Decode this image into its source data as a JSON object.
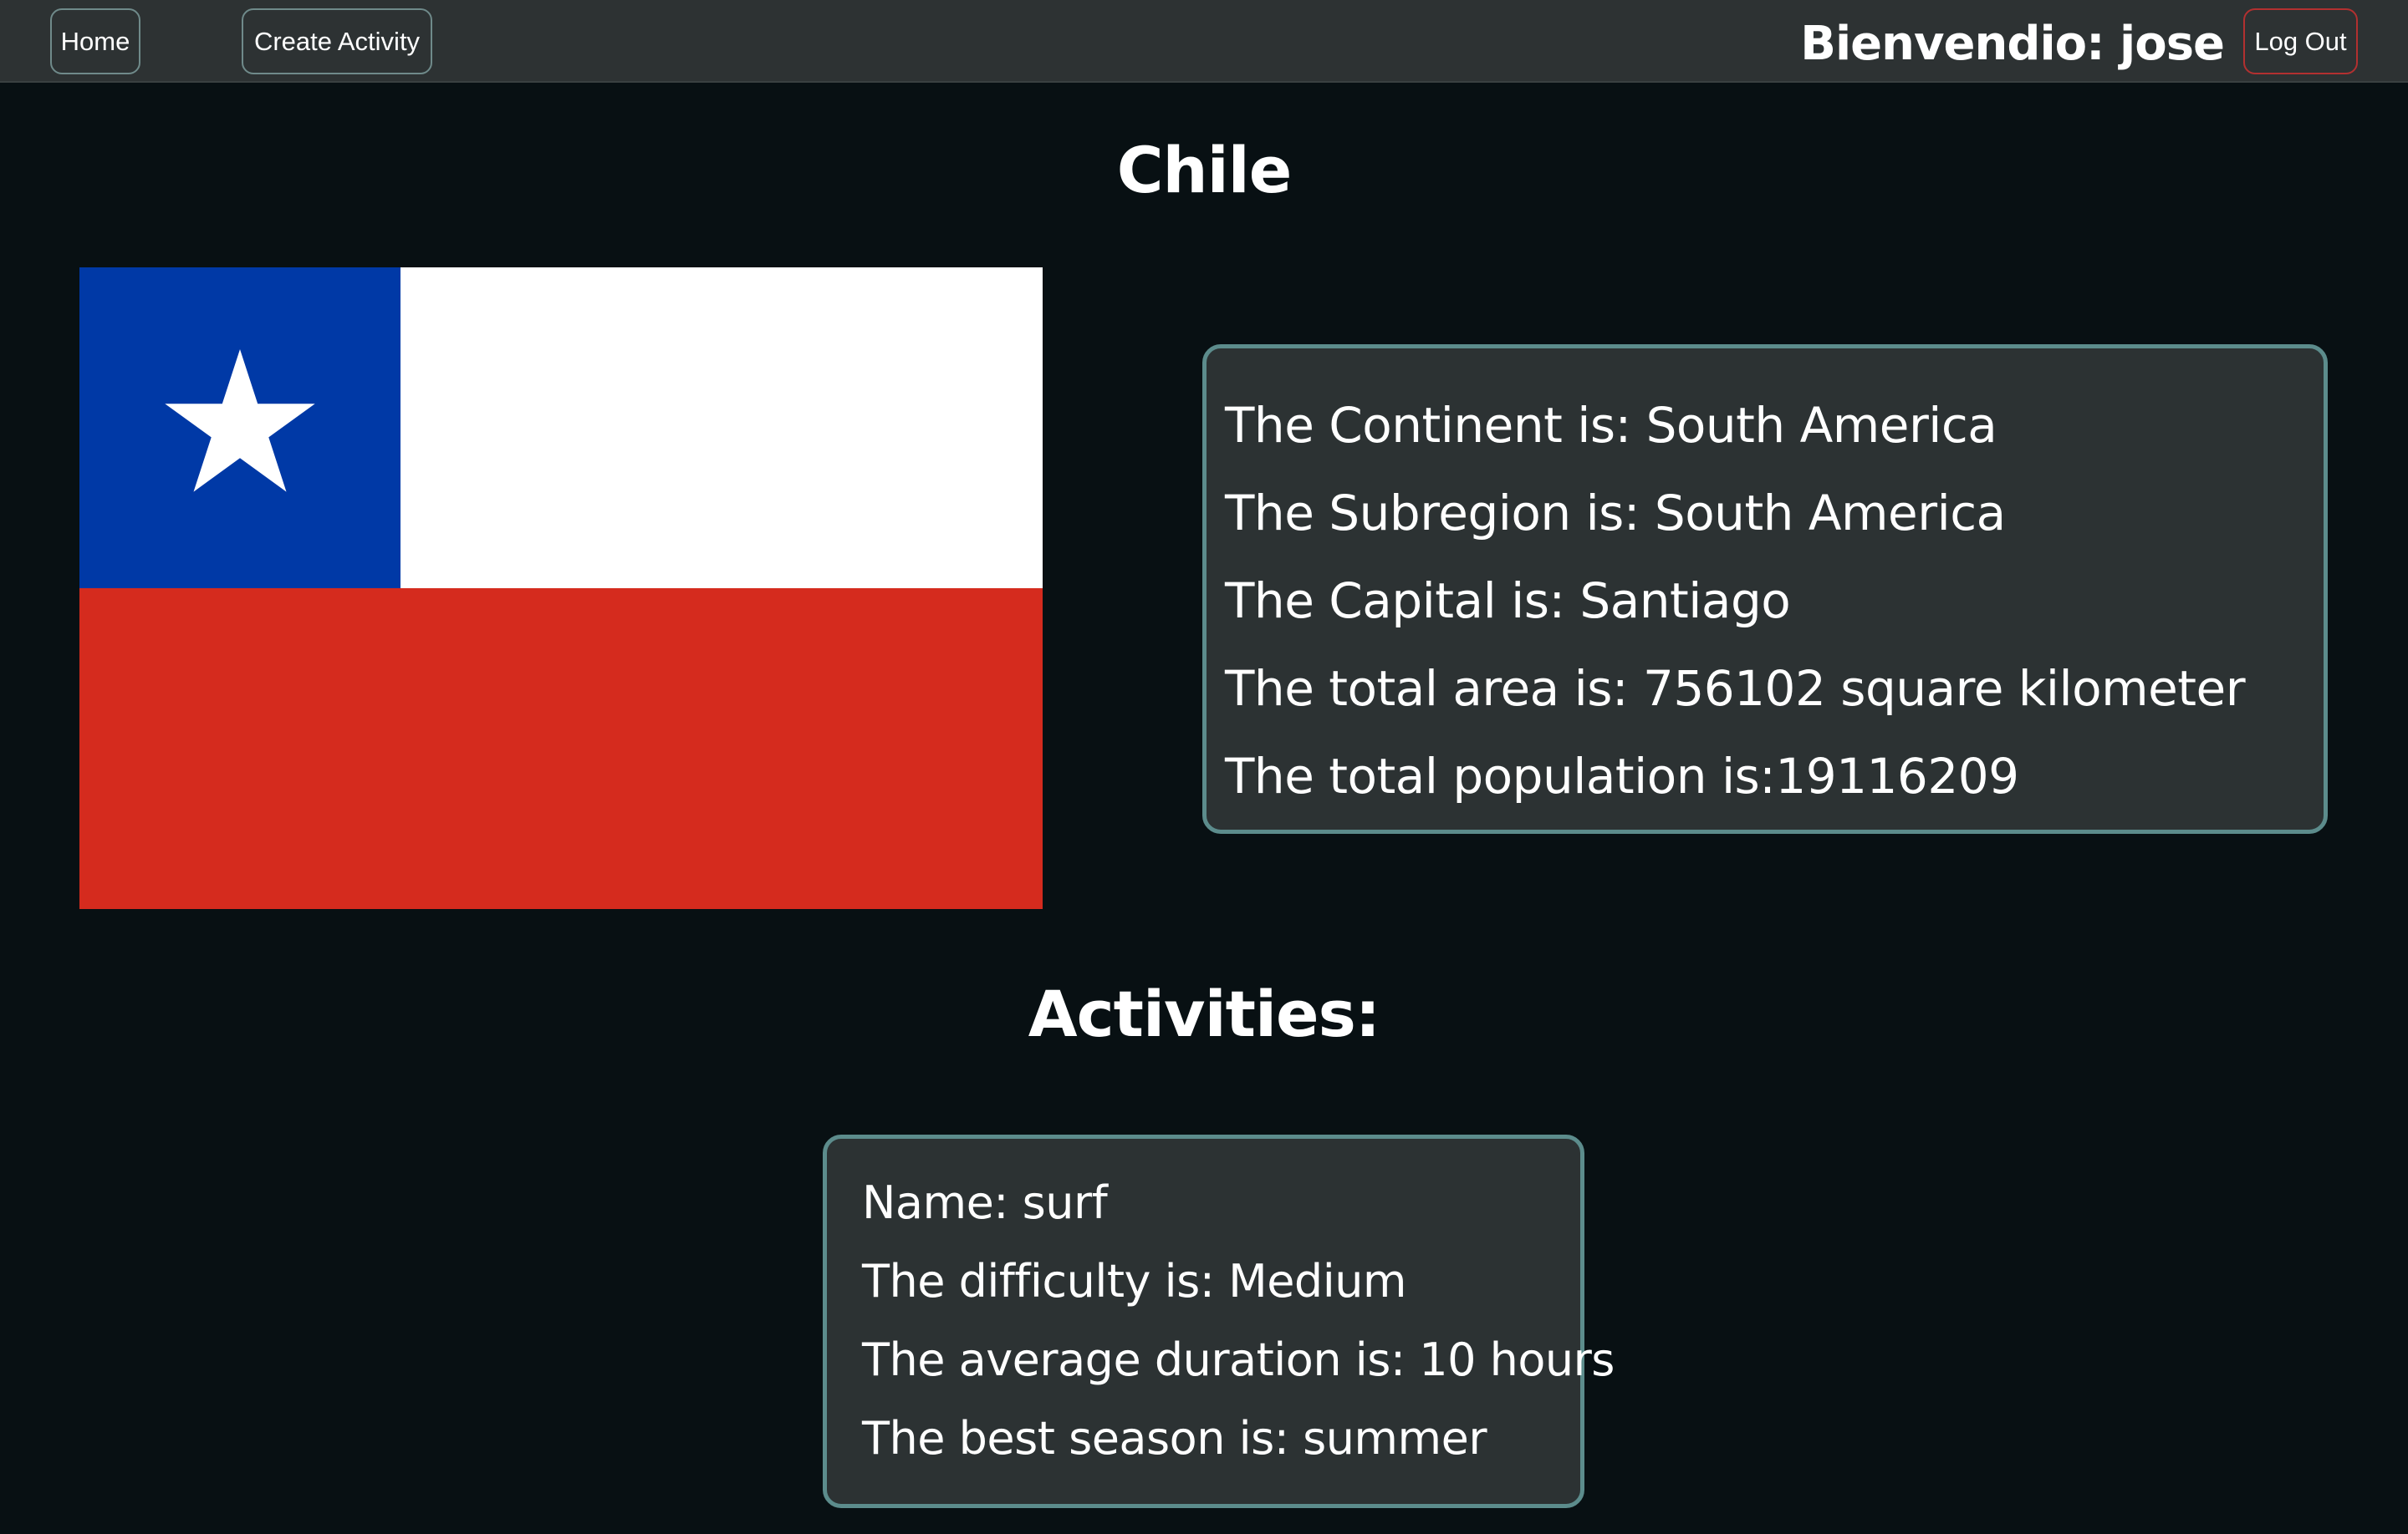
{
  "nav": {
    "home_label": "Home",
    "create_activity_label": "Create Activity",
    "welcome_text": "Bienvendio: jose",
    "logout_label": "Log Out"
  },
  "country": {
    "name": "Chile",
    "info": [
      "The Continent is: South America",
      "The Subregion is: South America",
      "The Capital is: Santiago",
      "The total area is: 756102 square kilometer",
      "The total population is:19116209"
    ]
  },
  "activities": {
    "heading": "Activities:",
    "items": [
      {
        "name": "Name: surf",
        "difficulty": "The difficulty is: Medium",
        "duration": "The average duration is: 10 hours",
        "season": "The best season is: summer"
      }
    ]
  },
  "colors": {
    "background": "#081013",
    "navbar": "#2d3233",
    "card": "#2c3233",
    "card_border": "#5c8c8c",
    "logout_border": "#b23030",
    "flag_blue": "#0039a6",
    "flag_white": "#ffffff",
    "flag_red": "#d52b1e"
  },
  "icons": {
    "flag": "chile-flag"
  }
}
